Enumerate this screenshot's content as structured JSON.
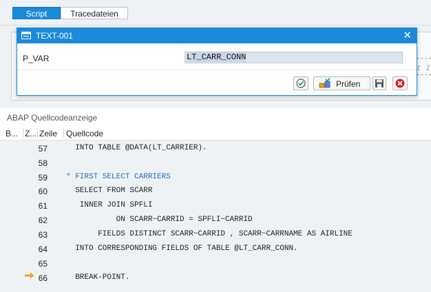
{
  "tabs": [
    {
      "label": "Script",
      "active": true
    },
    {
      "label": "Tracedateien",
      "active": false
    }
  ],
  "dialog": {
    "title": "TEXT-001",
    "field_label": "P_VAR",
    "field_value": "LT_CARR_CONN",
    "buttons": {
      "pruefen": "Prüfen"
    }
  },
  "source": {
    "section_title": "ABAP Quellcodeanzeige",
    "columns": [
      "B...",
      "Z...",
      "Zeile",
      "Quellcode"
    ],
    "lines": [
      {
        "num": "57",
        "code": "  INTO TABLE @DATA(LT_CARRIER).",
        "comment": false
      },
      {
        "num": "58",
        "code": "",
        "comment": false
      },
      {
        "num": "59",
        "code": "* FIRST SELECT CARRIERS",
        "comment": true
      },
      {
        "num": "60",
        "code": "  SELECT FROM SCARR",
        "comment": false
      },
      {
        "num": "61",
        "code": "   INNER JOIN SPFLI",
        "comment": false
      },
      {
        "num": "62",
        "code": "           ON SCARR~CARRID = SPFLI~CARRID",
        "comment": false
      },
      {
        "num": "63",
        "code": "       FIELDS DISTINCT SCARR~CARRID , SCARR~CARRNAME AS AIRLINE",
        "comment": false
      },
      {
        "num": "64",
        "code": "  INTO CORRESPONDING FIELDS OF TABLE @LT_CARR_CONN.",
        "comment": false
      },
      {
        "num": "65",
        "code": "",
        "comment": false
      },
      {
        "num": "66",
        "code": "  BREAK-POINT.",
        "comment": false
      }
    ],
    "current_line": "66"
  },
  "background_hint_letters": "t I"
}
